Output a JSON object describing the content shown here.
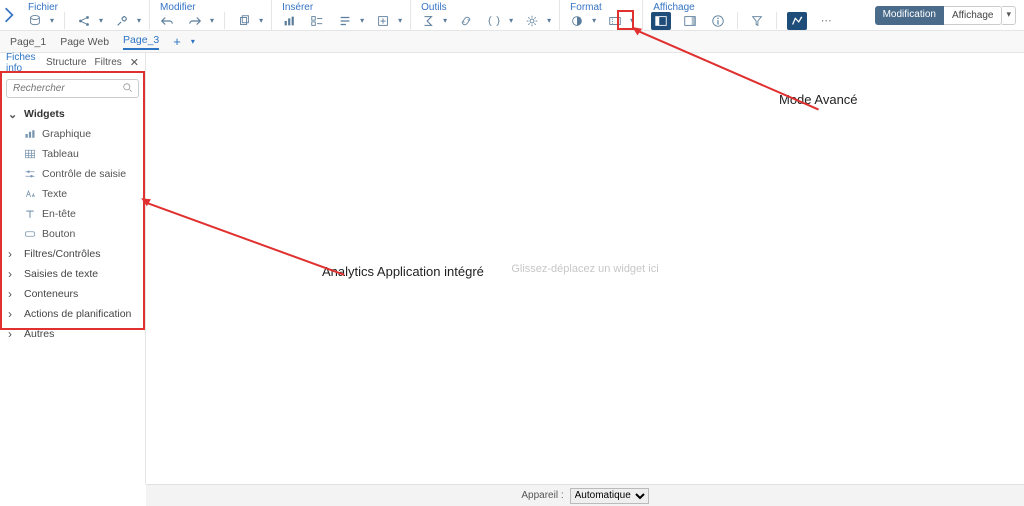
{
  "menubar": {
    "file": "Fichier",
    "edit": "Modifier",
    "insert": "Insérer",
    "tools": "Outils",
    "format": "Format",
    "view": "Affichage"
  },
  "mode": {
    "modification": "Modification",
    "view": "Affichage"
  },
  "tabs": [
    "Page_1",
    "Page Web",
    "Page_3"
  ],
  "panel": {
    "tabs": [
      "Fiches info",
      "Structure",
      "Filtres"
    ],
    "search_placeholder": "Rechercher"
  },
  "tree": {
    "widgets": {
      "label": "Widgets",
      "items": [
        "Graphique",
        "Tableau",
        "Contrôle de saisie",
        "Texte",
        "En-tête",
        "Bouton"
      ]
    },
    "sections": [
      "Filtres/Contrôles",
      "Saisies de texte",
      "Conteneurs",
      "Actions de planification",
      "Autres"
    ]
  },
  "canvas": {
    "hint": "Glissez-déplacez un widget ici"
  },
  "footer": {
    "device_label": "Appareil :",
    "device_value": "Automatique"
  },
  "annotations": {
    "advanced_mode": "Mode Avancé",
    "analytics_app": "Analytics Application intégré"
  }
}
